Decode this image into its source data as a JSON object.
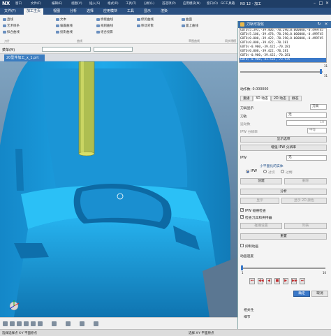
{
  "titlebar": {
    "logo": "NX",
    "quick_menus": [
      "窗口",
      "文件(F)",
      "编辑(E)",
      "视图(V)",
      "插入(S)",
      "格式(R)",
      "工具(T)",
      "分析(L)",
      "首选项(P)",
      "应用模块(N)",
      "窗口(O)",
      "GC工具箱",
      "帮助(H)"
    ],
    "window_title": "NX 12 - 加工"
  },
  "tabs": [
    "文件(F)",
    "加工主页",
    "视图",
    "分析",
    "选择",
    "应用模块",
    "工具",
    "显示",
    "渲染"
  ],
  "active_tab": "加工主页",
  "ribbon": {
    "groups": [
      "刀片",
      "曲线",
      "草图曲线",
      "同步建模"
    ],
    "items": [
      "直线",
      "艺术样条",
      "拟合曲线",
      "文本",
      "偏置曲线",
      "投影曲线",
      "桥接曲线",
      "规则曲线",
      "组合投影",
      "修剪曲线",
      "移动对象",
      "曲面",
      "面上曲线"
    ]
  },
  "toolbar2": {
    "filter_label": "菜单(M)",
    "filter_value": "",
    "scope_value": ""
  },
  "doc_tab": {
    "label": "20型件加工_x_1.prt"
  },
  "dialog": {
    "title": "刀轨可视化",
    "gcode_lines": [
      "GOTO/5.393,-39.406,-70.290,0.000000,-0.499745",
      "GOTO/5.106,-39.478,-70.290,0.000000,-0.499745",
      "GOTO/0.000,-39.422,-70.290,0.000000,-0.499745",
      "GOTO/0.000,-39.422,-70.281",
      "GOTO/-0.900,-39.422,-70.281",
      "GOTO/0.000,-39.422,-70.281",
      "GOTO/-0.900,-39.422,-70.281",
      "GOTO/-0.900,-41.532,-73.935"
    ],
    "selected_line_index": 7,
    "slider_top_max": "31",
    "slider_top_current": "31",
    "motion_label": "动作数: 0.000000",
    "subtabs": [
      "重播",
      "3D 动态",
      "2D 动态",
      "静态"
    ],
    "active_subtab": "3D 动态",
    "tool_display_label": "刀具显示",
    "tool_display_value": "刀具",
    "tool_label": "刀轨",
    "tool_value": "无",
    "motion_count_label": "运动数",
    "motion_count_value": "10",
    "ipw_res_label": "IPW 分辨率",
    "ipw_res_value": "中等",
    "btn_display_options": "显示选项",
    "btn_ipw_res": "增强 IPW 分辨率",
    "ipw_label": "IPW",
    "ipw_value": "无",
    "section_title": "小平面化的实体",
    "radio_labels": [
      "IPW",
      "过切",
      "过剩"
    ],
    "btn_create": "创建",
    "btn_delete": "删除",
    "btn_analyze": "分析",
    "btn_show": "显示",
    "btn_show_color": "显示 2D 颜色",
    "chk_ipw_collision": "IPW 碰撞检查",
    "chk_tool_holder": "检查刀具和夹持器",
    "btn_collision_settings": "碰撞设置",
    "btn_list": "列表",
    "btn_reset": "重置",
    "chk_trace": "抑制动画",
    "speed_label": "动画速度",
    "speed_min": "1",
    "speed_max": "10",
    "play_icons": [
      "⏮",
      "◀◀",
      "◀",
      "■",
      "▶",
      "▶▶",
      "⏭"
    ],
    "btn_ok": "确定",
    "btn_cancel": "取消"
  },
  "nav_panel": {
    "rows": [
      "相关性",
      "细节"
    ]
  },
  "status": {
    "left_text": "选择选择点 X-Y 平面原点",
    "right_text": "选择 X-Y 平面原点"
  },
  "colors": {
    "title_bg": "#1f3e66",
    "tab_bg": "#2b5081",
    "part_cyan": "#1a9ee0",
    "tool_yellow": "#b9c24a"
  }
}
